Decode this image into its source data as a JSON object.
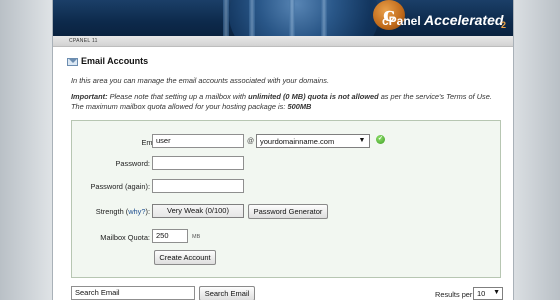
{
  "header": {
    "brand_mark": "c",
    "brand_name": "cPanel",
    "brand_suffix": "Accelerated",
    "brand_version": "2"
  },
  "breadcrumb": "CPANEL 11",
  "section": {
    "title": "Email Accounts",
    "intro": "In this area you can manage the email accounts associated with your domains.",
    "note_label": "Important:",
    "note_part1": " Please note that setting up a mailbox with ",
    "note_emph": "unlimited (0 MB) quota is not allowed",
    "note_part2": " as per the service's Terms of Use. The maximum mailbox quota allowed for your hosting package is: ",
    "note_max": "500MB"
  },
  "form": {
    "email_label": "Email:",
    "email_value": "user",
    "at_symbol": "@",
    "domain_selected": "yourdomainname.com",
    "password_label": "Password:",
    "password_value": "",
    "password_again_label": "Password (again):",
    "password_again_value": "",
    "strength_label_prefix": "Strength (",
    "strength_why": "why?",
    "strength_label_suffix": "):",
    "strength_value": "Very Weak (0/100)",
    "password_generator_label": "Password Generator",
    "quota_label": "Mailbox Quota:",
    "quota_value": "250",
    "quota_unit": "MB",
    "create_label": "Create Account",
    "status_icon": "check-icon"
  },
  "search": {
    "placeholder": "Search Email",
    "button_label": "Search Email",
    "results_label": "Results per page:",
    "results_value": "10"
  },
  "colors": {
    "banner": "#0d2a4c",
    "form_background": "#f2f7f1",
    "link": "#1f4f8f",
    "brand_accent": "#f0a64a"
  }
}
